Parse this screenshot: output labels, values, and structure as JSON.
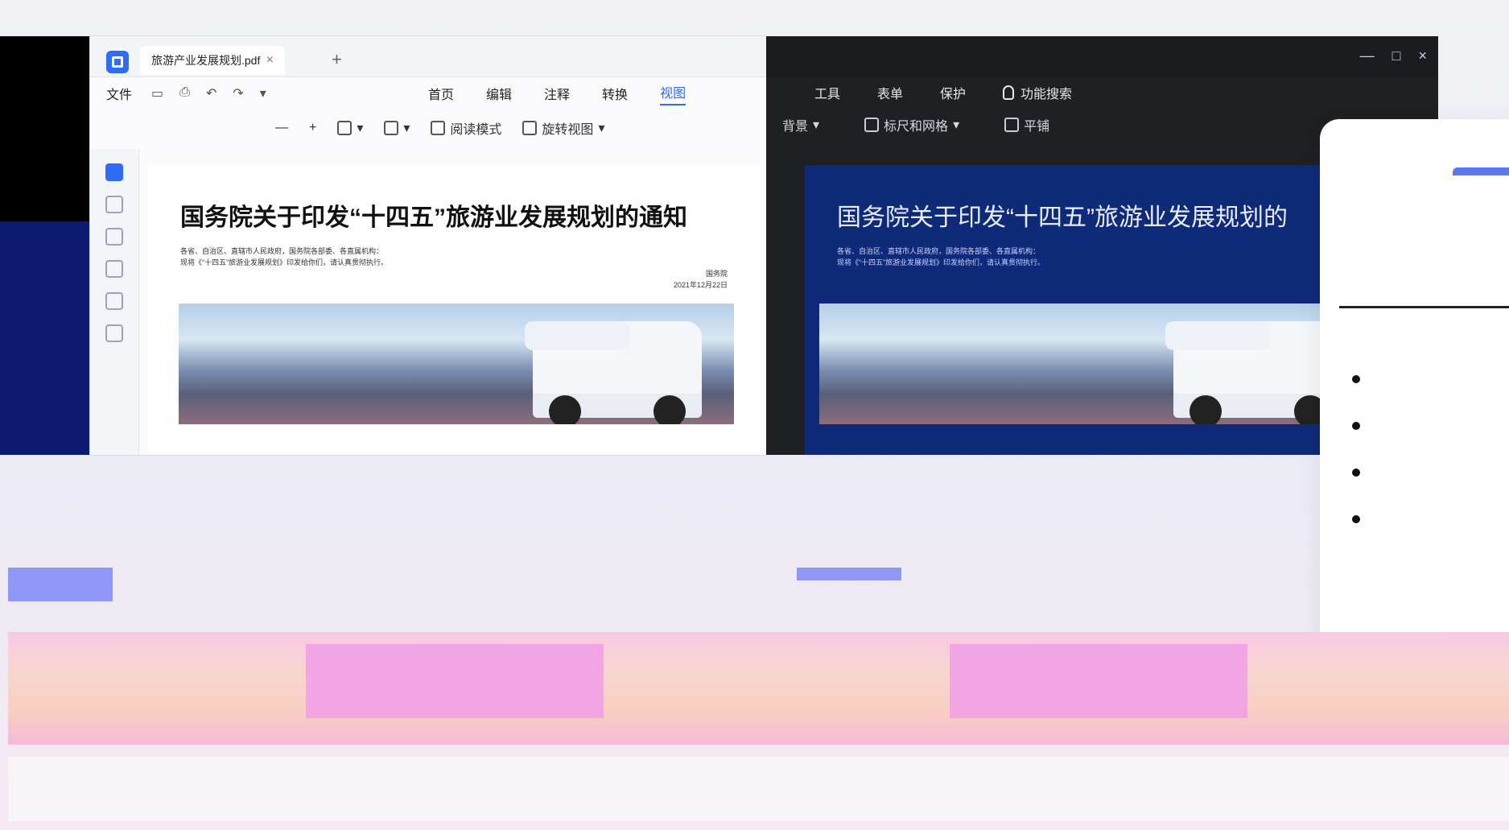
{
  "light_window": {
    "tab_title": "旅游产业发展规划.pdf",
    "tab_close": "×",
    "new_tab": "+",
    "menu": {
      "file": "文件",
      "tabs": [
        "首页",
        "编辑",
        "注释",
        "转换",
        "视图"
      ],
      "active_tab": "视图"
    },
    "toolbar": {
      "zoom_out": "—",
      "zoom_in": "+",
      "read_mode": "阅读模式",
      "rotate_view": "旋转视图"
    },
    "document": {
      "title": "国务院关于印发“十四五”旅游业发展规划的通知",
      "line1": "各省、自治区、直辖市人民政府，国务院各部委、各直属机构：",
      "line2": "现将《“十四五”旅游业发展规划》印发给你们，请认真贯彻执行。",
      "sign_org": "国务院",
      "sign_date": "2021年12月22日"
    }
  },
  "dark_window": {
    "menu": [
      "工具",
      "表单",
      "保护"
    ],
    "search_label": "功能搜索",
    "toolbar": {
      "background": "背景",
      "ruler_grid": "标尺和网格",
      "tile": "平铺"
    },
    "window_buttons": [
      "—",
      "□",
      "×"
    ],
    "document": {
      "title": "国务院关于印发“十四五”旅游业发展规划的"
    }
  },
  "colors": {
    "accent": "#2f6cf6",
    "dark_bg": "#1f2024",
    "popup_accent": "#5b78f2"
  }
}
